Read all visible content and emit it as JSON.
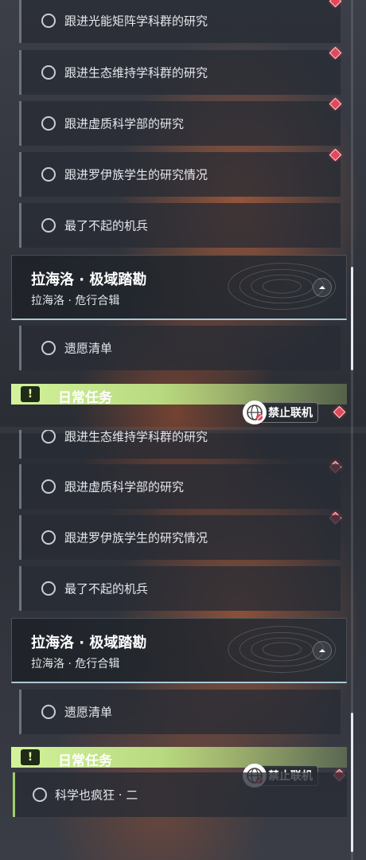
{
  "panelA": {
    "quests": [
      {
        "label": "跟进光能矩阵学科群的研究"
      },
      {
        "label": "跟进生态维持学科群的研究"
      },
      {
        "label": "跟进虚质科学部的研究"
      },
      {
        "label": "跟进罗伊族学生的研究情况"
      },
      {
        "label": "最了不起的机兵"
      }
    ],
    "event": {
      "title": "拉海洛 · 极域踏勘",
      "subtitle": "拉海洛 · 危行合辑"
    },
    "event_quest": {
      "label": "遗愿清单"
    },
    "daily_header": {
      "label": "日常任务",
      "icon": "!"
    },
    "offline": {
      "label": "禁止联机"
    }
  },
  "panelB": {
    "quests": [
      {
        "label": "跟进生态维持学科群的研究"
      },
      {
        "label": "跟进虚质科学部的研究"
      },
      {
        "label": "跟进罗伊族学生的研究情况"
      },
      {
        "label": "最了不起的机兵"
      }
    ],
    "event": {
      "title": "拉海洛 · 极域踏勘",
      "subtitle": "拉海洛 · 危行合辑"
    },
    "event_quest": {
      "label": "遗愿清单"
    },
    "daily_header": {
      "label": "日常任务",
      "icon": "!"
    },
    "offline": {
      "label": "禁止联机"
    },
    "daily_quest": {
      "label": "科学也疯狂 · 二"
    }
  },
  "colors": {
    "accent_green": "#c8ec8c",
    "badge_red": "#e2475a",
    "row_bg": "#282c34"
  }
}
